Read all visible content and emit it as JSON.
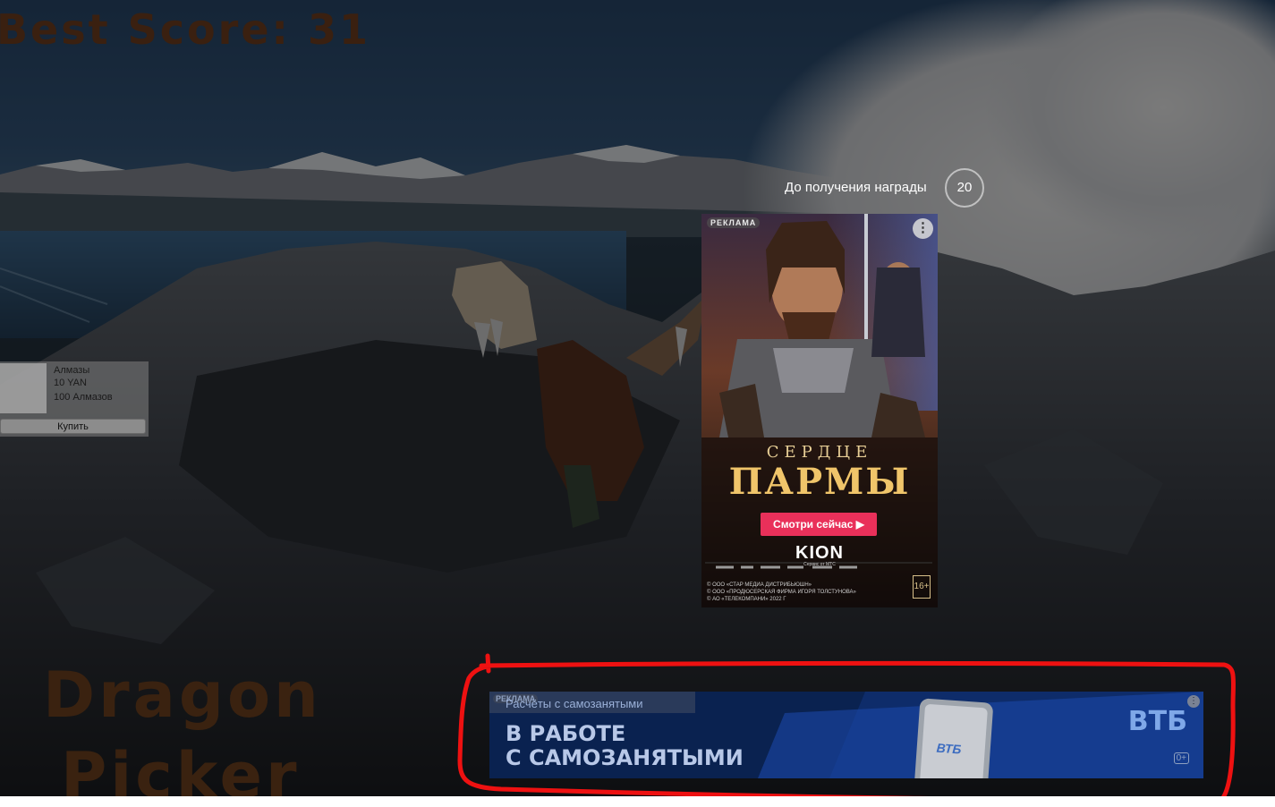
{
  "hud": {
    "best_score": "Best Score: 31",
    "title_line_1": "Dragon",
    "title_line_2": "Picker"
  },
  "shop": {
    "item_name": "Алмазы",
    "item_price": "10 YAN",
    "item_detail": "100 Алмазов",
    "buy_label": "Купить"
  },
  "reward": {
    "label": "До получения награды",
    "countdown": "20"
  },
  "poster_ad": {
    "tag": "РЕКЛАМА",
    "subtitle": "СЕРДЦЕ",
    "title": "ПАРМЫ",
    "cta": "Смотри сейчас ▶",
    "brand": "KION",
    "brand_sub": "Сервис от МТС",
    "legal_1": "© ООО «СТАР МЕДИА ДИСТРИБЬЮШН»",
    "legal_2": "© ООО «ПРОДЮСЕРСКАЯ ФИРМА ИГОРЯ ТОЛСТУНОВА»",
    "legal_3": "© АО «ТЕЛЕКОМПАНИ» 2022 Г",
    "age": "16+"
  },
  "banner_ad": {
    "tag": "РЕКЛАМА",
    "topline": "Расчёты с самозанятыми",
    "headline_1": "В РАБОТЕ",
    "headline_2": "С САМОЗАНЯТЫМИ",
    "logo": "ВТБ",
    "phone_logo": "ВТБ",
    "age": "0+"
  },
  "colors": {
    "annotation": "#ee1111",
    "cta": "#e9305a",
    "title_text": "#3a2210"
  }
}
